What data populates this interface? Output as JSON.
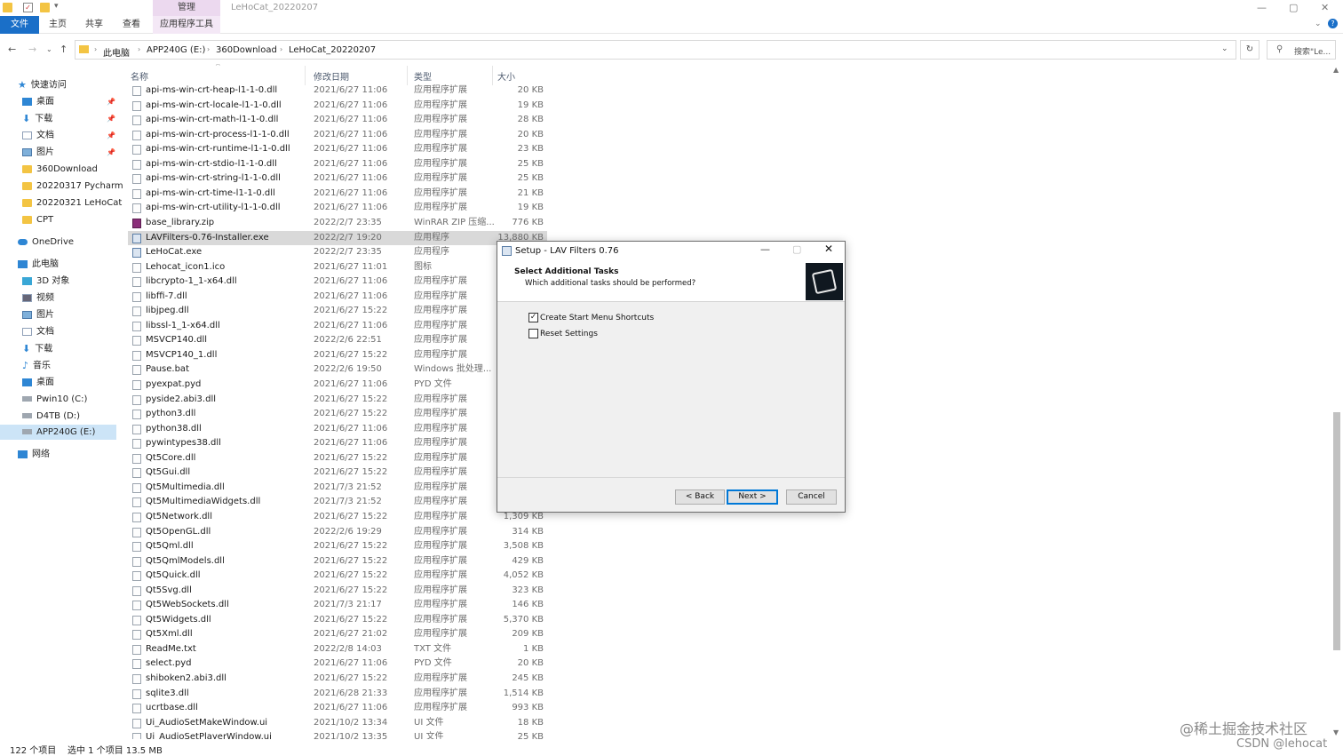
{
  "window": {
    "title": "LeHoCat_20220207",
    "context_tab": "管理",
    "controls": [
      "—",
      "▢",
      "✕"
    ]
  },
  "ribbon": {
    "tabs": [
      "文件",
      "主页",
      "共享",
      "查看",
      "应用程序工具"
    ]
  },
  "address": {
    "breadcrumbs": [
      "此电脑",
      "APP240G (E:)",
      "360Download",
      "LeHoCat_20220207"
    ],
    "search_placeholder": "搜索\"Le..."
  },
  "nav": {
    "quick_access": "快速访问",
    "quick_items": [
      "桌面",
      "下载",
      "文档",
      "图片",
      "360Download",
      "20220317 Pycharm",
      "20220321 LeHoCat",
      "CPT"
    ],
    "onedrive": "OneDrive",
    "this_pc": "此电脑",
    "pc_items": [
      "3D 对象",
      "视频",
      "图片",
      "文档",
      "下载",
      "音乐",
      "桌面",
      "Pwin10 (C:)",
      "D4TB (D:)",
      "APP240G (E:)"
    ],
    "network": "网络"
  },
  "list": {
    "columns": [
      "名称",
      "修改日期",
      "类型",
      "大小"
    ],
    "rows": [
      [
        "api-ms-win-crt-heap-l1-1-0.dll",
        "2021/6/27 11:06",
        "应用程序扩展",
        "20 KB"
      ],
      [
        "api-ms-win-crt-locale-l1-1-0.dll",
        "2021/6/27 11:06",
        "应用程序扩展",
        "19 KB"
      ],
      [
        "api-ms-win-crt-math-l1-1-0.dll",
        "2021/6/27 11:06",
        "应用程序扩展",
        "28 KB"
      ],
      [
        "api-ms-win-crt-process-l1-1-0.dll",
        "2021/6/27 11:06",
        "应用程序扩展",
        "20 KB"
      ],
      [
        "api-ms-win-crt-runtime-l1-1-0.dll",
        "2021/6/27 11:06",
        "应用程序扩展",
        "23 KB"
      ],
      [
        "api-ms-win-crt-stdio-l1-1-0.dll",
        "2021/6/27 11:06",
        "应用程序扩展",
        "25 KB"
      ],
      [
        "api-ms-win-crt-string-l1-1-0.dll",
        "2021/6/27 11:06",
        "应用程序扩展",
        "25 KB"
      ],
      [
        "api-ms-win-crt-time-l1-1-0.dll",
        "2021/6/27 11:06",
        "应用程序扩展",
        "21 KB"
      ],
      [
        "api-ms-win-crt-utility-l1-1-0.dll",
        "2021/6/27 11:06",
        "应用程序扩展",
        "19 KB"
      ],
      [
        "base_library.zip",
        "2022/2/7 23:35",
        "WinRAR ZIP 压缩...",
        "776 KB"
      ],
      [
        "LAVFilters-0.76-Installer.exe",
        "2022/2/7 19:20",
        "应用程序",
        "13,880 KB"
      ],
      [
        "LeHoCat.exe",
        "2022/2/7 23:35",
        "应用程序",
        ""
      ],
      [
        "Lehocat_icon1.ico",
        "2021/6/27 11:01",
        "图标",
        ""
      ],
      [
        "libcrypto-1_1-x64.dll",
        "2021/6/27 11:06",
        "应用程序扩展",
        ""
      ],
      [
        "libffi-7.dll",
        "2021/6/27 11:06",
        "应用程序扩展",
        ""
      ],
      [
        "libjpeg.dll",
        "2021/6/27 15:22",
        "应用程序扩展",
        ""
      ],
      [
        "libssl-1_1-x64.dll",
        "2021/6/27 11:06",
        "应用程序扩展",
        ""
      ],
      [
        "MSVCP140.dll",
        "2022/2/6 22:51",
        "应用程序扩展",
        ""
      ],
      [
        "MSVCP140_1.dll",
        "2021/6/27 15:22",
        "应用程序扩展",
        ""
      ],
      [
        "Pause.bat",
        "2022/2/6 19:50",
        "Windows 批处理...",
        ""
      ],
      [
        "pyexpat.pyd",
        "2021/6/27 11:06",
        "PYD 文件",
        ""
      ],
      [
        "pyside2.abi3.dll",
        "2021/6/27 15:22",
        "应用程序扩展",
        ""
      ],
      [
        "python3.dll",
        "2021/6/27 15:22",
        "应用程序扩展",
        ""
      ],
      [
        "python38.dll",
        "2021/6/27 11:06",
        "应用程序扩展",
        ""
      ],
      [
        "pywintypes38.dll",
        "2021/6/27 11:06",
        "应用程序扩展",
        ""
      ],
      [
        "Qt5Core.dll",
        "2021/6/27 15:22",
        "应用程序扩展",
        ""
      ],
      [
        "Qt5Gui.dll",
        "2021/6/27 15:22",
        "应用程序扩展",
        ""
      ],
      [
        "Qt5Multimedia.dll",
        "2021/7/3 21:52",
        "应用程序扩展",
        ""
      ],
      [
        "Qt5MultimediaWidgets.dll",
        "2021/7/3 21:52",
        "应用程序扩展",
        ""
      ],
      [
        "Qt5Network.dll",
        "2021/6/27 15:22",
        "应用程序扩展",
        "1,309 KB"
      ],
      [
        "Qt5OpenGL.dll",
        "2022/2/6 19:29",
        "应用程序扩展",
        "314 KB"
      ],
      [
        "Qt5Qml.dll",
        "2021/6/27 15:22",
        "应用程序扩展",
        "3,508 KB"
      ],
      [
        "Qt5QmlModels.dll",
        "2021/6/27 15:22",
        "应用程序扩展",
        "429 KB"
      ],
      [
        "Qt5Quick.dll",
        "2021/6/27 15:22",
        "应用程序扩展",
        "4,052 KB"
      ],
      [
        "Qt5Svg.dll",
        "2021/6/27 15:22",
        "应用程序扩展",
        "323 KB"
      ],
      [
        "Qt5WebSockets.dll",
        "2021/7/3 21:17",
        "应用程序扩展",
        "146 KB"
      ],
      [
        "Qt5Widgets.dll",
        "2021/6/27 15:22",
        "应用程序扩展",
        "5,370 KB"
      ],
      [
        "Qt5Xml.dll",
        "2021/6/27 21:02",
        "应用程序扩展",
        "209 KB"
      ],
      [
        "ReadMe.txt",
        "2022/2/8 14:03",
        "TXT 文件",
        "1 KB"
      ],
      [
        "select.pyd",
        "2021/6/27 11:06",
        "PYD 文件",
        "20 KB"
      ],
      [
        "shiboken2.abi3.dll",
        "2021/6/27 15:22",
        "应用程序扩展",
        "245 KB"
      ],
      [
        "sqlite3.dll",
        "2021/6/28 21:33",
        "应用程序扩展",
        "1,514 KB"
      ],
      [
        "ucrtbase.dll",
        "2021/6/27 11:06",
        "应用程序扩展",
        "993 KB"
      ],
      [
        "Ui_AudioSetMakeWindow.ui",
        "2021/10/2 13:34",
        "UI 文件",
        "18 KB"
      ],
      [
        "Ui_AudioSetPlayerWindow.ui",
        "2021/10/2 13:35",
        "UI 文件",
        "25 KB"
      ]
    ],
    "selected_row": 10
  },
  "status": {
    "count": "122 个项目",
    "selection": "选中 1 个项目  13.5 MB"
  },
  "dialog": {
    "title": "Setup - LAV Filters 0.76",
    "heading": "Select Additional Tasks",
    "subheading": "Which additional tasks should be performed?",
    "tasks": [
      {
        "label": "Create Start Menu Shortcuts",
        "checked": true
      },
      {
        "label": "Reset Settings",
        "checked": false
      }
    ],
    "buttons": {
      "back": "< Back",
      "next": "Next >",
      "cancel": "Cancel"
    }
  },
  "watermark": {
    "line1": "@稀土掘金技术社区",
    "line2": "CSDN @lehocat"
  }
}
